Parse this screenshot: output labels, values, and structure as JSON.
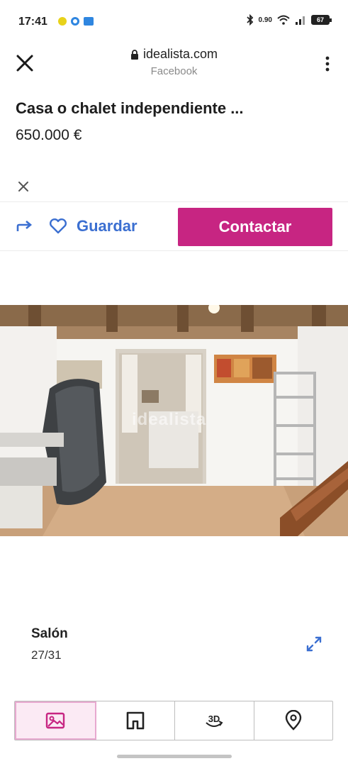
{
  "status_bar": {
    "time": "17:41",
    "net_speed": "0.90",
    "battery": "67"
  },
  "browser": {
    "url": "idealista.com",
    "referrer": "Facebook"
  },
  "listing": {
    "title": "Casa o chalet independiente ...",
    "price": "650.000 €"
  },
  "actions": {
    "save_label": "Guardar",
    "contact_label": "Contactar"
  },
  "photo": {
    "watermark": "idealista",
    "caption": "Salón",
    "counter": "27/31"
  },
  "tabs": [
    {
      "icon": "photos-icon",
      "active": true
    },
    {
      "icon": "floorplan-icon",
      "active": false
    },
    {
      "icon": "3d-tour-icon",
      "active": false
    },
    {
      "icon": "map-pin-icon",
      "active": false
    }
  ],
  "colors": {
    "brand": "#c72582",
    "link_blue": "#3b6fd1",
    "tab_active_bg": "#fbeaf4"
  }
}
